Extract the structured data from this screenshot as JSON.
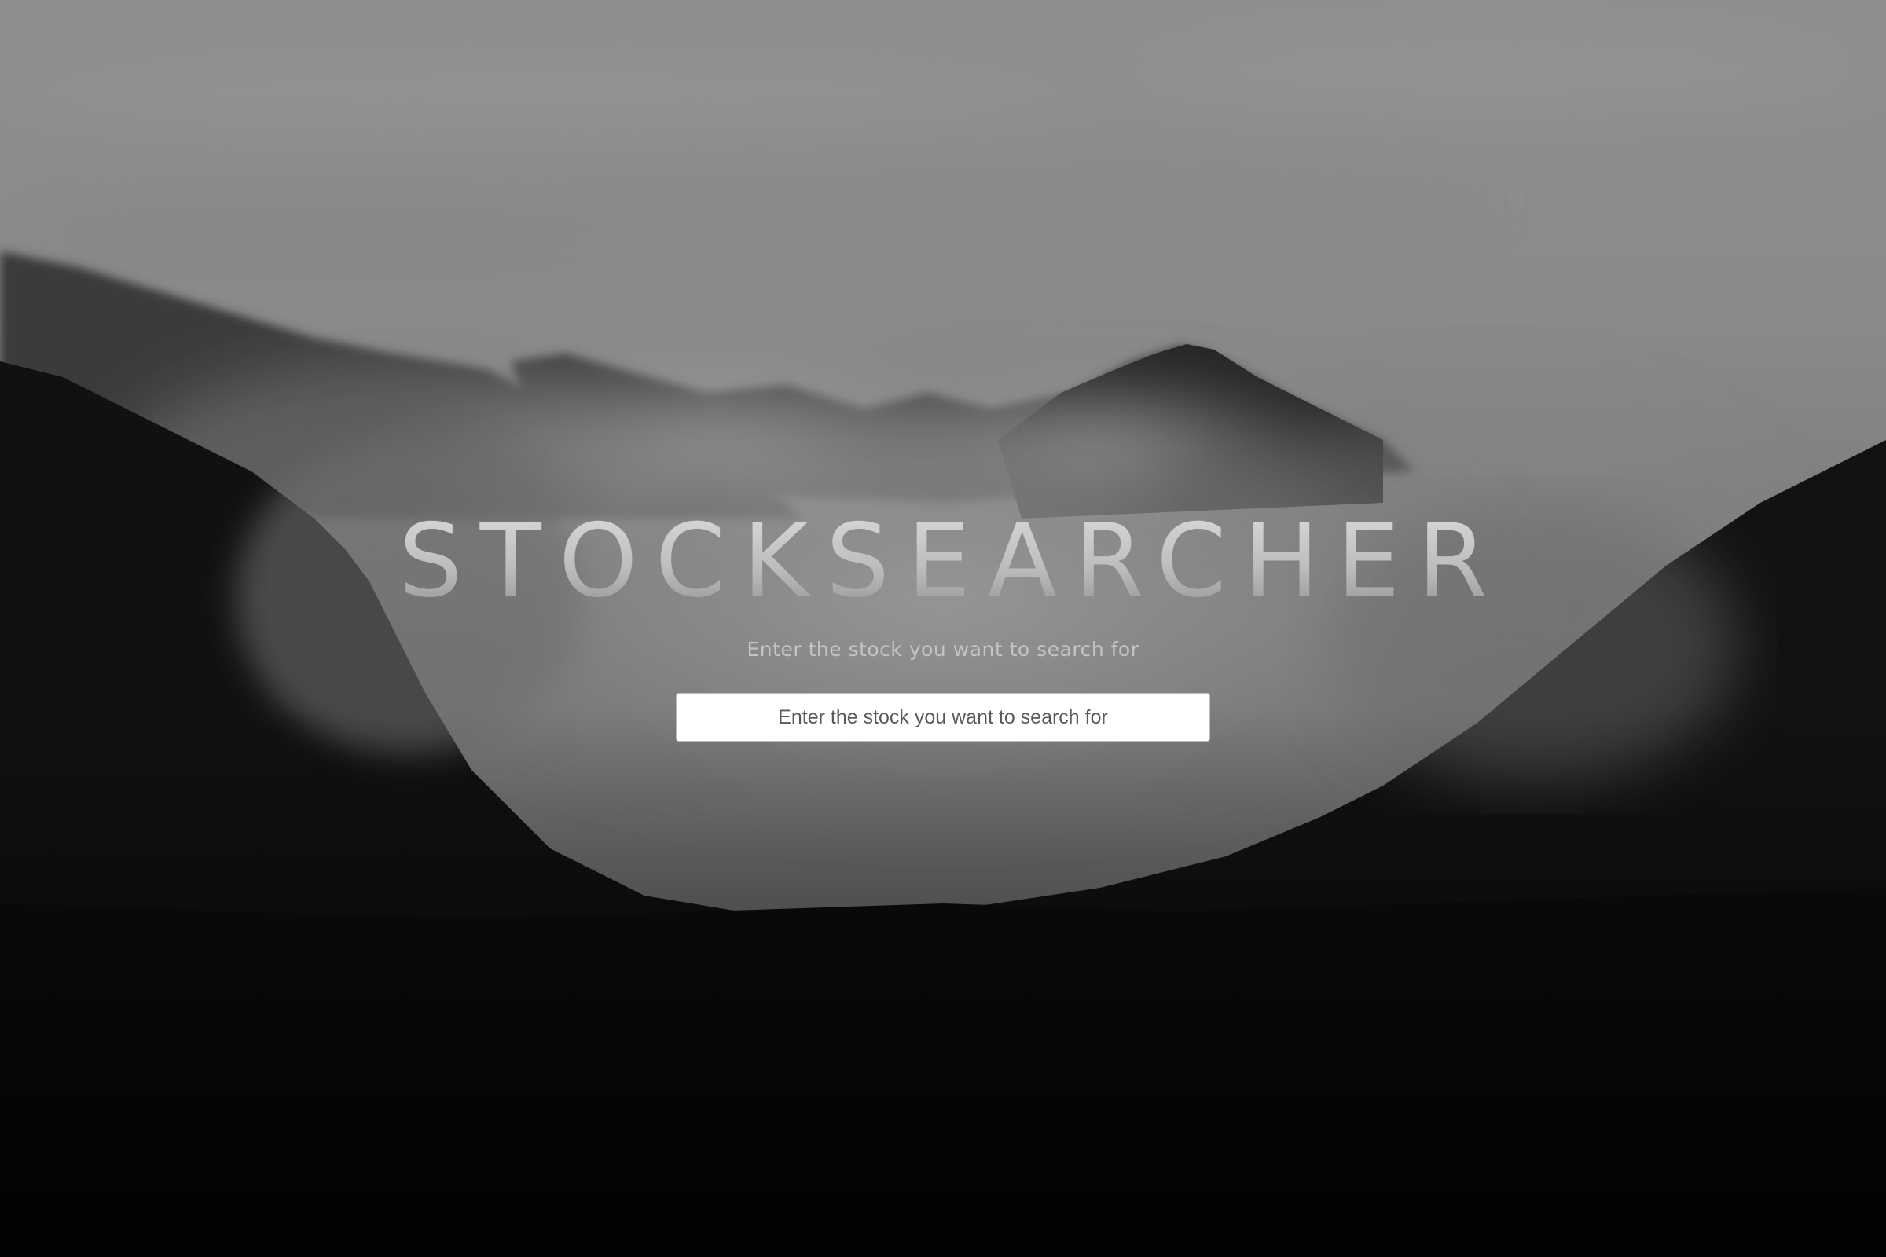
{
  "app": {
    "title": "STOCKSEARCHER",
    "subtitle": "Enter the stock you want to search for"
  },
  "search": {
    "placeholder": "Enter the stock you want to search for",
    "value": ""
  },
  "colors": {
    "background": "#0a0a0a",
    "input_background": "#ffffff",
    "subtitle_text": "#c4c4c4"
  }
}
